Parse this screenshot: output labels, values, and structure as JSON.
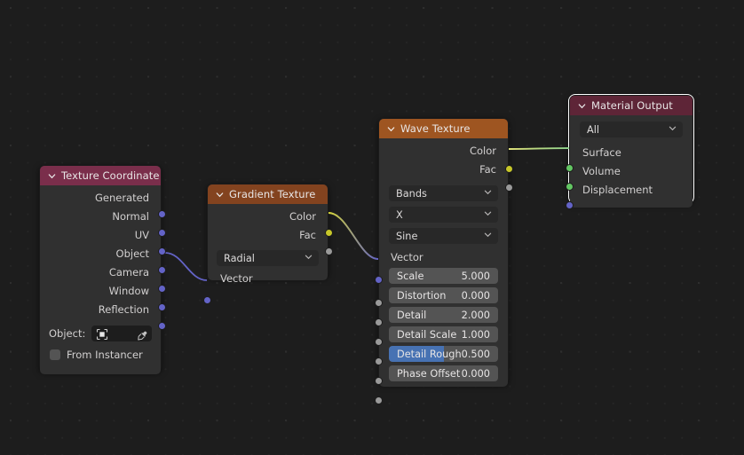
{
  "editor": {
    "name": "blender-shader-node-editor",
    "background_color": "#1d1d1d",
    "grid_dot_color": "#2e2e2e"
  },
  "nodes": {
    "texture_coordinate": {
      "title": "Texture Coordinate",
      "header_color": "#7a2e4b",
      "outputs": [
        {
          "label": "Generated",
          "socket": "vector"
        },
        {
          "label": "Normal",
          "socket": "vector"
        },
        {
          "label": "UV",
          "socket": "vector"
        },
        {
          "label": "Object",
          "socket": "vector"
        },
        {
          "label": "Camera",
          "socket": "vector"
        },
        {
          "label": "Window",
          "socket": "vector"
        },
        {
          "label": "Reflection",
          "socket": "vector"
        }
      ],
      "object_field": {
        "label": "Object:",
        "value": "",
        "icon": "object-icon",
        "picker_icon": "eyedropper-icon"
      },
      "from_instancer": {
        "label": "From Instancer",
        "checked": false
      }
    },
    "gradient_texture": {
      "title": "Gradient Texture",
      "header_color": "#83431f",
      "outputs": [
        {
          "label": "Color",
          "socket": "color"
        },
        {
          "label": "Fac",
          "socket": "gray"
        }
      ],
      "type_dropdown": {
        "value": "Radial"
      },
      "inputs": [
        {
          "label": "Vector",
          "socket": "vector"
        }
      ]
    },
    "wave_texture": {
      "title": "Wave Texture",
      "header_color": "#9e5521",
      "selected": true,
      "outputs": [
        {
          "label": "Color",
          "socket": "color"
        },
        {
          "label": "Fac",
          "socket": "gray"
        }
      ],
      "dropdowns": [
        {
          "value": "Bands"
        },
        {
          "value": "X"
        },
        {
          "value": "Sine"
        }
      ],
      "inputs": [
        {
          "label": "Vector",
          "socket": "vector"
        }
      ],
      "sliders": [
        {
          "label": "Scale",
          "value": "5.000",
          "fill": 0,
          "highlighted": false
        },
        {
          "label": "Distortion",
          "value": "0.000",
          "fill": 0,
          "highlighted": false
        },
        {
          "label": "Detail",
          "value": "2.000",
          "fill": 0,
          "highlighted": false
        },
        {
          "label": "Detail Scale",
          "value": "1.000",
          "fill": 0,
          "highlighted": false
        },
        {
          "label": "Detail Rough",
          "value": "0.500",
          "fill": 50,
          "highlighted": true
        },
        {
          "label": "Phase Offset",
          "value": "0.000",
          "fill": 0,
          "highlighted": false
        }
      ]
    },
    "material_output": {
      "title": "Material Output",
      "header_color": "#5e2537",
      "active": true,
      "target_dropdown": {
        "value": "All"
      },
      "inputs": [
        {
          "label": "Surface",
          "socket": "shader"
        },
        {
          "label": "Volume",
          "socket": "shader"
        },
        {
          "label": "Displacement",
          "socket": "vector"
        }
      ]
    }
  },
  "links": [
    {
      "from": "texture_coordinate.Object",
      "to": "gradient_texture.Vector",
      "from_color": "#6363c7",
      "to_color": "#6363c7"
    },
    {
      "from": "gradient_texture.Color",
      "to": "wave_texture.Vector",
      "from_color": "#c7c729",
      "to_color": "#6363c7"
    },
    {
      "from": "wave_texture.Color",
      "to": "material_output.Surface",
      "from_color": "#c7c729",
      "to_color": "#63c763"
    }
  ]
}
